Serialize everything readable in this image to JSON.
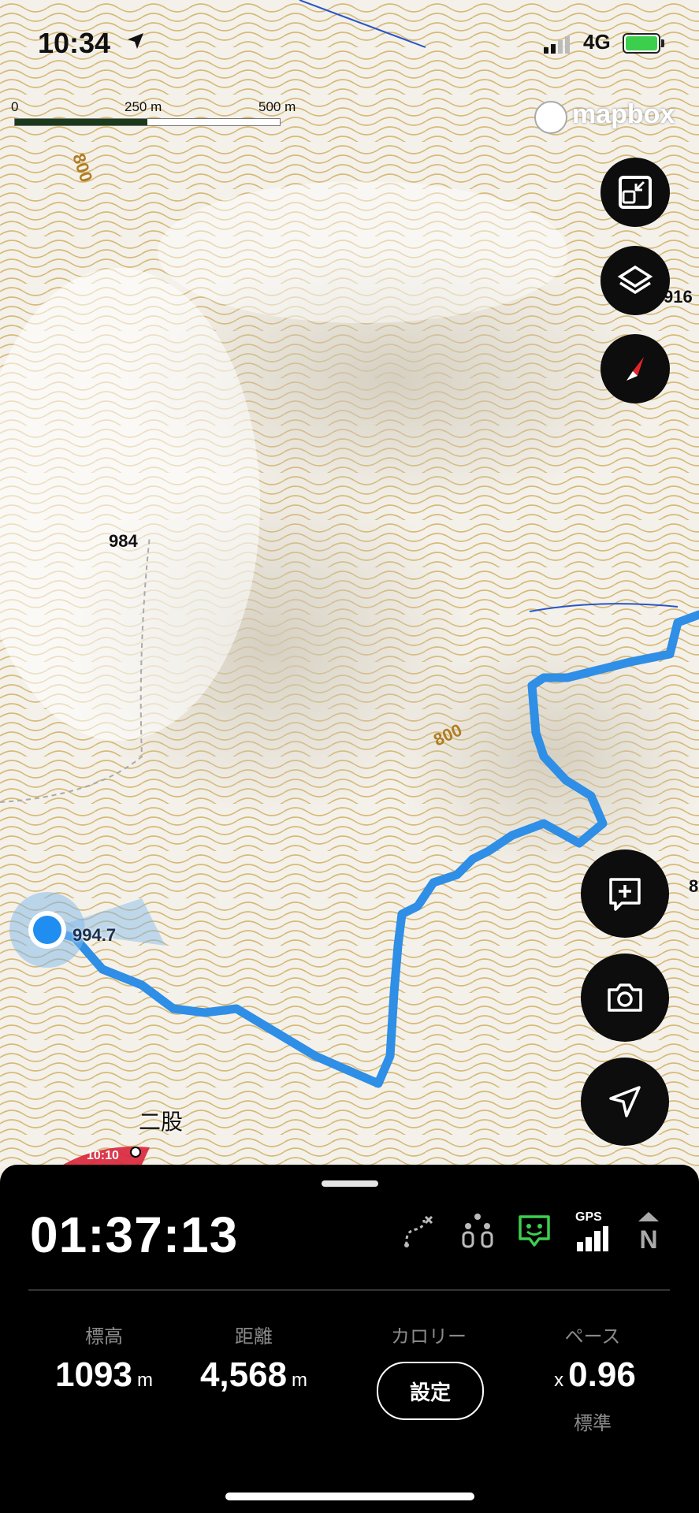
{
  "status": {
    "time": "10:34",
    "network": "4G"
  },
  "scale": {
    "labels": [
      "0",
      "250 m",
      "500 m"
    ]
  },
  "attribution": "mapbox",
  "map_labels": {
    "peak_984": "984",
    "contour_800_top": "800",
    "contour_800_mid": "800",
    "edge_916": "916",
    "edge_8": "8",
    "current_elev": "994.7",
    "place_futamata": "二股",
    "red_note": "10:10"
  },
  "colors": {
    "track": "#2f8ee6",
    "contour": "#c9a14a",
    "panel": "#000000",
    "gps_active": "#3ccf4e"
  },
  "panel": {
    "elapsed": "01:37:13",
    "stats": [
      {
        "label": "標高",
        "value": "1093",
        "unit": "m"
      },
      {
        "label": "距離",
        "value": "4,568",
        "unit": "m"
      },
      {
        "label": "カロリー",
        "button": "設定"
      },
      {
        "label": "ペース",
        "prefix": "x",
        "value": "0.96",
        "sub": "標準"
      }
    ],
    "indicators": {
      "gps": "GPS",
      "north": "N"
    }
  },
  "icons": [
    "location-arrow-icon",
    "map-fit-icon",
    "layers-icon",
    "compass-icon",
    "add-note-icon",
    "camera-icon",
    "navigate-icon",
    "route-icon",
    "people-icon",
    "chat-icon",
    "gps-signal-icon",
    "north-icon"
  ]
}
